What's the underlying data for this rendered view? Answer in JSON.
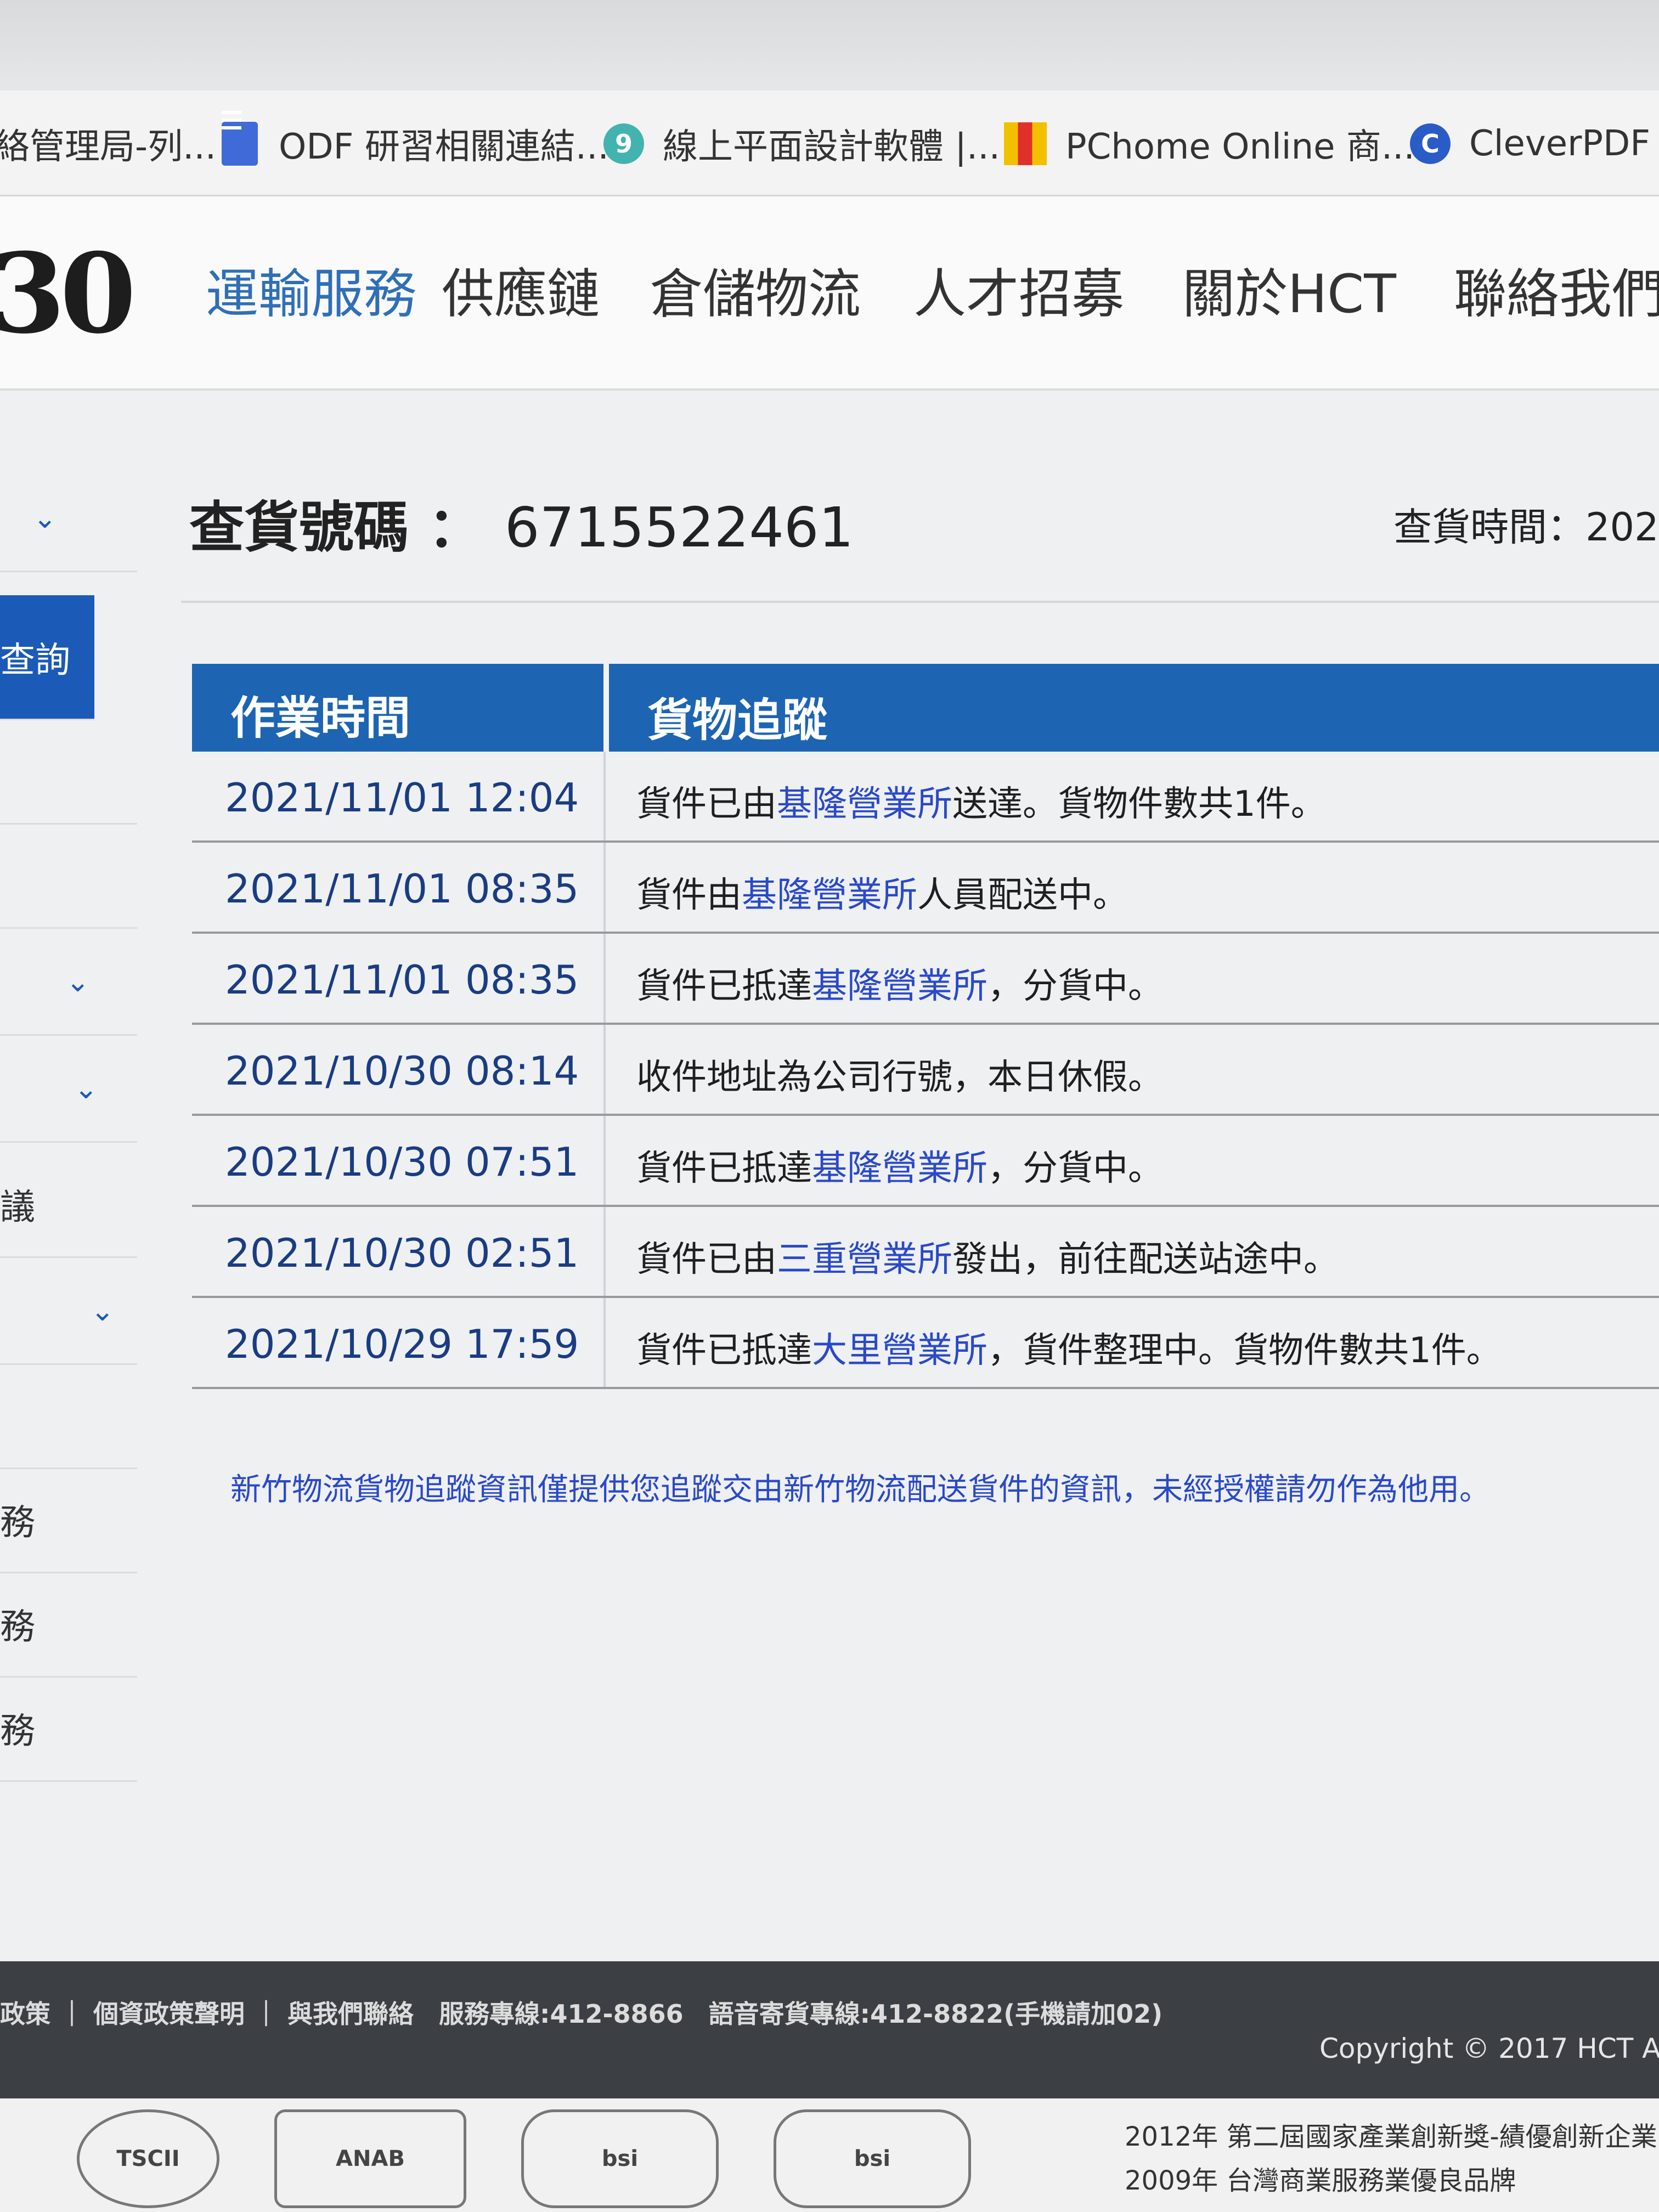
{
  "bookmarks": [
    {
      "label": "絡管理局-列...",
      "icon": "none"
    },
    {
      "label": "ODF 研習相關連結...",
      "icon": "doc-icon"
    },
    {
      "label": "線上平面設計軟體 |...",
      "icon": "circle-icon"
    },
    {
      "label": "PChome Online 商...",
      "icon": "pchome-icon"
    },
    {
      "label": "CleverPDF -",
      "icon": "cleverpdf-icon"
    }
  ],
  "nav": {
    "logo_fragment": "30",
    "items": [
      "運輸服務",
      "供應鏈",
      "倉儲物流",
      "人才招募",
      "關於HCT",
      "聯絡我們"
    ]
  },
  "sidebar": {
    "items": [
      "",
      "查詢",
      "",
      "",
      "",
      "",
      "",
      "議",
      "",
      "",
      "務",
      "務",
      "務"
    ]
  },
  "tracking": {
    "number_label": "查貨號碼 ：",
    "number": "6715522461",
    "time_label": "查貨時間：202"
  },
  "table": {
    "headers": [
      "作業時間",
      "貨物追蹤"
    ],
    "rows": [
      {
        "time": "2021/11/01 12:04",
        "pre": "貨件已由",
        "station": "基隆營業所",
        "post": "送達。貨物件數共1件。"
      },
      {
        "time": "2021/11/01 08:35",
        "pre": "貨件由",
        "station": "基隆營業所",
        "post": "人員配送中。"
      },
      {
        "time": "2021/11/01 08:35",
        "pre": "貨件已抵達",
        "station": "基隆營業所",
        "post": "，分貨中。"
      },
      {
        "time": "2021/10/30 08:14",
        "pre": "收件地址為公司行號，本日休假。",
        "station": "",
        "post": ""
      },
      {
        "time": "2021/10/30 07:51",
        "pre": "貨件已抵達",
        "station": "基隆營業所",
        "post": "，分貨中。"
      },
      {
        "time": "2021/10/30 02:51",
        "pre": "貨件已由",
        "station": "三重營業所",
        "post": "發出，前往配送站途中。"
      },
      {
        "time": "2021/10/29 17:59",
        "pre": "貨件已抵達",
        "station": "大里營業所",
        "post": "，貨件整理中。貨物件數共1件。"
      }
    ]
  },
  "notice": "新竹物流貨物追蹤資訊僅提供您追蹤交由新竹物流配送貨件的資訊，未經授權請勿作為他用。",
  "footer": {
    "links": "政策 ｜ 個資政策聲明 ｜ 與我們聯絡　服務專線:412-8866　語音寄貨專線:412-8822(手機請加02)",
    "copyright": "Copyright © 2017 HCT Al",
    "awards": [
      "2012年 第二屆國家產業創新獎-績優創新企業",
      "2009年 台灣商業服務業優良品牌"
    ],
    "badges": [
      "TSCII",
      "ANAB",
      "bsi",
      "bsi"
    ]
  }
}
